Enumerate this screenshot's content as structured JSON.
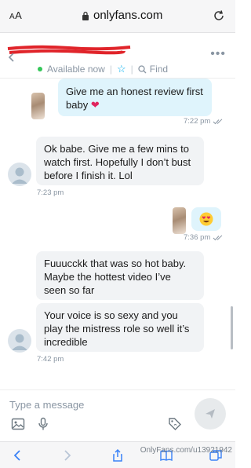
{
  "browser": {
    "text_size_label": "AA",
    "url": "onlyfans.com"
  },
  "header": {
    "status": "Available now",
    "find_label": "Find"
  },
  "messages": [
    {
      "direction": "out",
      "text_line1": "Give me an honest review first",
      "text_line2": "baby",
      "emoji": "heart",
      "time": "7:22 pm"
    },
    {
      "direction": "in",
      "text_line1": "Ok babe. Give me a few mins to",
      "text_line2": "watch first. Hopefully I don’t bust",
      "text_line3": "before I finish it. Lol",
      "time": "7:23 pm"
    },
    {
      "direction": "out",
      "emoji": "heart-eyes-face",
      "time": "7:36 pm"
    },
    {
      "direction": "in",
      "text_line1": "Fuuucckk that was so hot baby.",
      "text_line2": "Maybe the hottest video I’ve",
      "text_line3": "seen so far"
    },
    {
      "direction": "in",
      "text_line1": "Your voice is so sexy and you",
      "text_line2": "play the mistress role so well it’s",
      "text_line3": "incredible",
      "time": "7:42 pm"
    }
  ],
  "composer": {
    "placeholder": "Type a message"
  },
  "watermark": "OnlyFans.com/u13921942",
  "colors": {
    "accent": "#00aff0",
    "outgoing_bubble": "#dff4fc",
    "incoming_bubble": "#f1f3f5",
    "online_dot": "#34c759"
  },
  "icons": [
    "lock-icon",
    "reload-icon",
    "back-icon",
    "star-icon",
    "search-icon",
    "more-icon",
    "image-icon",
    "microphone-icon",
    "price-tag-icon",
    "send-icon",
    "nav-back-icon",
    "nav-forward-icon",
    "share-icon",
    "bookmarks-icon",
    "tabs-icon"
  ]
}
